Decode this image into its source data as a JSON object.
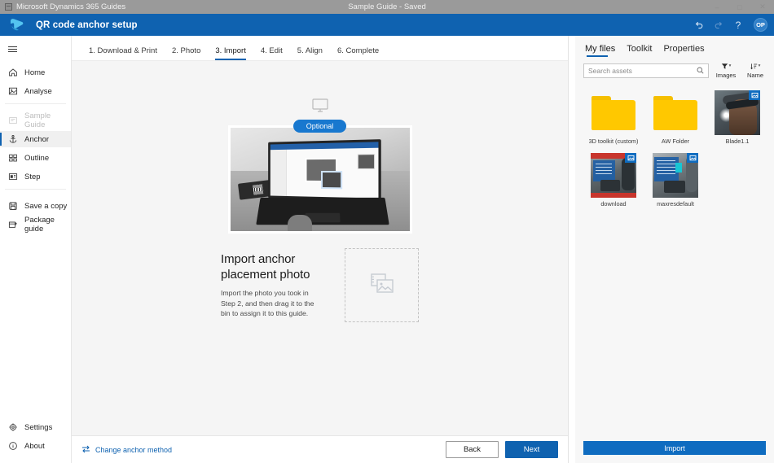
{
  "window": {
    "app_name": "Microsoft Dynamics 365 Guides",
    "document_title": "Sample Guide - Saved",
    "controls": {
      "minimize": "–",
      "maximize": "□",
      "close": "✕"
    }
  },
  "command_bar": {
    "title": "QR code anchor setup",
    "undo_icon": "undo-icon",
    "redo_icon": "redo-icon",
    "help_label": "?",
    "avatar_initials": "OP",
    "background": "#0f62b0"
  },
  "sidebar": {
    "menu_icon": "hamburger-icon",
    "groups": [
      {
        "items": [
          {
            "label": "Home",
            "icon": "home-icon",
            "state": "normal"
          },
          {
            "label": "Analyse",
            "icon": "analyse-icon",
            "state": "normal"
          }
        ]
      },
      {
        "items": [
          {
            "label": "Sample Guide",
            "icon": "guide-icon",
            "state": "disabled"
          },
          {
            "label": "Anchor",
            "icon": "anchor-icon",
            "state": "selected"
          },
          {
            "label": "Outline",
            "icon": "outline-icon",
            "state": "normal"
          },
          {
            "label": "Step",
            "icon": "step-icon",
            "state": "normal"
          }
        ]
      },
      {
        "items": [
          {
            "label": "Save a copy",
            "icon": "save-copy-icon",
            "state": "normal"
          },
          {
            "label": "Package guide",
            "icon": "package-icon",
            "state": "normal"
          }
        ]
      }
    ],
    "bottom_items": [
      {
        "label": "Settings",
        "icon": "gear-icon"
      },
      {
        "label": "About",
        "icon": "info-icon"
      }
    ]
  },
  "main": {
    "steps": [
      {
        "label": "1. Download & Print",
        "active": false
      },
      {
        "label": "2. Photo",
        "active": false
      },
      {
        "label": "3. Import",
        "active": true
      },
      {
        "label": "4. Edit",
        "active": false
      },
      {
        "label": "5. Align",
        "active": false
      },
      {
        "label": "6. Complete",
        "active": false
      }
    ],
    "hero": {
      "device_icon": "monitor-icon",
      "badge_label": "Optional",
      "photo_alt": "laptop-with-guides-app-photo"
    },
    "heading": "Import anchor placement photo",
    "description": "Import the photo you took in Step 2, and then drag it to the bin to assign it to this guide.",
    "dropzone_icon": "image-placeholder-icon",
    "footer": {
      "change_method_label": "Change anchor method",
      "change_method_icon": "swap-arrows-icon",
      "back_label": "Back",
      "next_label": "Next"
    }
  },
  "right_panel": {
    "tabs": [
      {
        "label": "My files",
        "active": true
      },
      {
        "label": "Toolkit",
        "active": false
      },
      {
        "label": "Properties",
        "active": false
      }
    ],
    "search": {
      "placeholder": "Search assets",
      "value": "",
      "icon": "search-icon"
    },
    "filter": {
      "label": "Images",
      "icon": "filter-icon",
      "chevron": "chevron-down-icon"
    },
    "sort": {
      "label": "Name",
      "icon": "sort-icon",
      "chevron": "chevron-down-icon"
    },
    "files": [
      {
        "name": "3D toolkit (custom)",
        "type": "folder"
      },
      {
        "name": "AW Folder",
        "type": "folder"
      },
      {
        "name": "Blade1.1",
        "type": "image",
        "art": "blade",
        "badge": "image-badge-icon"
      },
      {
        "name": "download",
        "type": "image",
        "art": "download",
        "badge": "image-badge-icon"
      },
      {
        "name": "maxresdefault",
        "type": "image",
        "art": "max",
        "badge": "image-badge-icon"
      }
    ],
    "import_label": "Import",
    "accent": "#0f6cc0"
  }
}
